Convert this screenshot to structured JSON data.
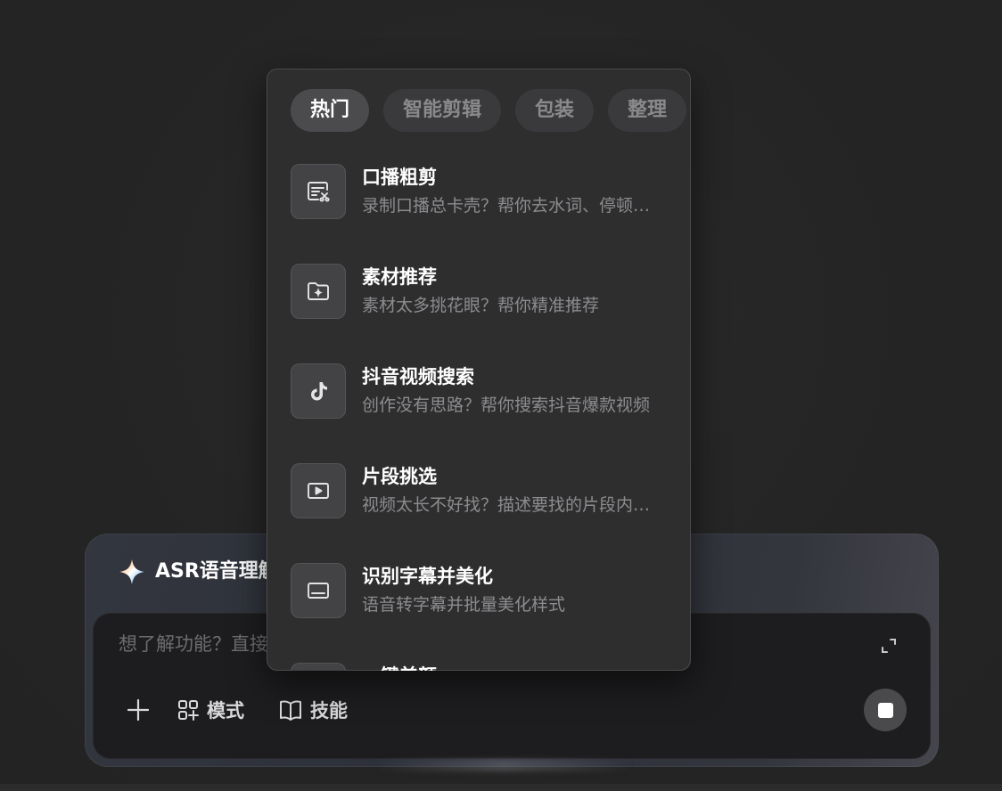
{
  "popup": {
    "tabs": [
      {
        "label": "热门",
        "active": true
      },
      {
        "label": "智能剪辑",
        "active": false
      },
      {
        "label": "包装",
        "active": false
      },
      {
        "label": "整理",
        "active": false
      }
    ],
    "items": [
      {
        "title": "口播粗剪",
        "description": "录制口播总卡壳？帮你去水词、停顿…",
        "icon": "subtitle-cut-icon"
      },
      {
        "title": "素材推荐",
        "description": "素材太多挑花眼？帮你精准推荐",
        "icon": "folder-sparkle-icon"
      },
      {
        "title": "抖音视频搜索",
        "description": "创作没有思路？帮你搜索抖音爆款视频",
        "icon": "tiktok-icon"
      },
      {
        "title": "片段挑选",
        "description": "视频太长不好找？描述要找的片段内…",
        "icon": "play-screen-icon"
      },
      {
        "title": "识别字幕并美化",
        "description": "语音转字幕并批量美化样式",
        "icon": "captions-icon"
      },
      {
        "title": "一键美颜",
        "description": "",
        "icon": "face-icon"
      }
    ]
  },
  "composer": {
    "title": "ASR语音理解",
    "placeholder": "想了解功能？直接问我",
    "mode_label": "模式",
    "skill_label": "技能",
    "icons": {
      "title": "sparkle-icon",
      "expand": "expand-icon",
      "add": "plus-icon",
      "mode": "grid-sparkle-icon",
      "skill": "book-icon",
      "stop": "stop-icon"
    }
  },
  "colors": {
    "background": "#262626",
    "popup_bg": "#2e2e2f",
    "tab_active_bg": "#4b4b4e",
    "input_bg": "#1d1d1f",
    "text_primary": "#ffffff",
    "text_secondary": "#8c8c8f"
  }
}
